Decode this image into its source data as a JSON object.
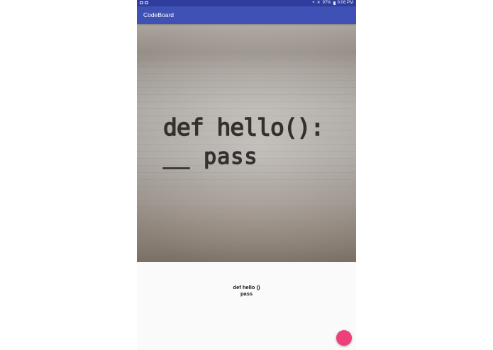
{
  "status_bar": {
    "notification_icons": [
      "image-notification-icon",
      "gallery-notification-icon"
    ],
    "location_icon": "location-icon",
    "mute_icon": "mute-icon",
    "battery": "97%",
    "time": "8:06 PM"
  },
  "app_bar": {
    "title": "CodeBoard",
    "color": "#3f51b5"
  },
  "photo": {
    "handwritten_lines": [
      "def hello():",
      "__ pass"
    ]
  },
  "result": {
    "lines": [
      "def hello ()",
      "pass"
    ]
  },
  "fab": {
    "color": "#ec407a"
  }
}
